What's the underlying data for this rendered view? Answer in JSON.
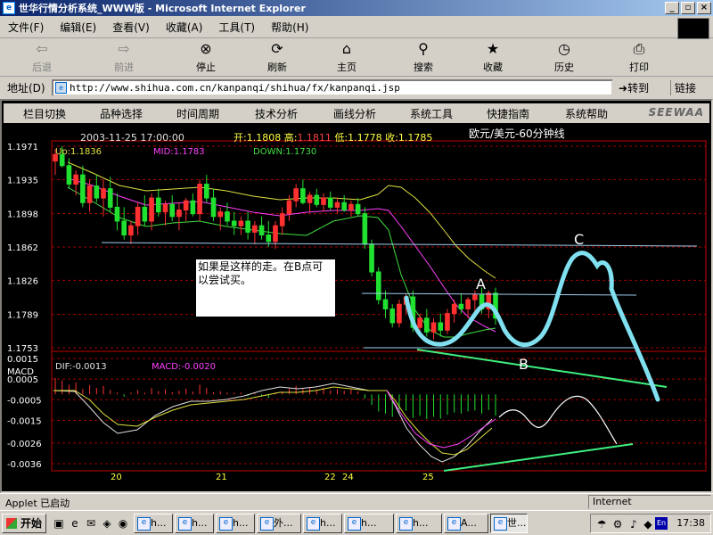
{
  "window": {
    "title": "世华行情分析系统_WWW版 - Microsoft Internet Explorer"
  },
  "menu": [
    "文件(F)",
    "编辑(E)",
    "查看(V)",
    "收藏(A)",
    "工具(T)",
    "帮助(H)"
  ],
  "toolbar": [
    {
      "label": "后退",
      "icon": "back-arrow-icon",
      "enabled": false
    },
    {
      "label": "前进",
      "icon": "forward-arrow-icon",
      "enabled": false
    },
    {
      "label": "停止",
      "icon": "stop-icon",
      "enabled": true
    },
    {
      "label": "刷新",
      "icon": "refresh-icon",
      "enabled": true
    },
    {
      "label": "主页",
      "icon": "home-icon",
      "enabled": true
    },
    {
      "label": "搜索",
      "icon": "search-icon",
      "enabled": true
    },
    {
      "label": "收藏",
      "icon": "favorites-icon",
      "enabled": true
    },
    {
      "label": "历史",
      "icon": "history-icon",
      "enabled": true
    },
    {
      "label": "打印",
      "icon": "print-icon",
      "enabled": true
    }
  ],
  "address": {
    "label": "地址(D)",
    "url": "http://www.shihua.com.cn/kanpanqi/shihua/fx/kanpanqi.jsp",
    "go": "转到",
    "links": "链接"
  },
  "app_menu": [
    "栏目切换",
    "品种选择",
    "时间周期",
    "技术分析",
    "画线分析",
    "系统工具",
    "快捷指南",
    "系统帮助"
  ],
  "app_logo": "SEEWAA",
  "quote": {
    "datetime": "2003-11-25 17:00:00",
    "open_label": "开:",
    "open": "1.1808",
    "high_label": "高:",
    "high": "1.1811",
    "low_label": "低:",
    "low": "1.1778",
    "close_label": "收:",
    "close": "1.1785",
    "symbol": "欧元/美元-60分钟线"
  },
  "bollinger": {
    "up": "Up:1.1836",
    "mid": "MID:1.1783",
    "down": "DOWN:1.1730"
  },
  "macd_info": {
    "label": "MACD",
    "dif": "DIF:-0.0013",
    "macd": "MACD:-0.0020"
  },
  "annotation": {
    "text": "如果是这样的走。在B点可以尝试买。",
    "labels": [
      "A",
      "B",
      "C"
    ]
  },
  "colors": {
    "up": "#ff3030",
    "down": "#20e030",
    "mid": "#ff40ff",
    "upper": "#e0e040",
    "lower": "#40e040",
    "hand": "#80e0f0",
    "trend": "#40f080"
  },
  "chart_data": {
    "type": "candlestick",
    "price_axis": {
      "ticks": [
        "1.1971",
        "1.1935",
        "1.1898",
        "1.1862",
        "1.1826",
        "1.1789",
        "1.1753"
      ],
      "range": [
        1.1753,
        1.1971
      ]
    },
    "macd_axis": {
      "ticks": [
        "0.0015",
        "0.0005",
        "-0.0005",
        "-0.0015",
        "-0.0026",
        "-0.0036"
      ],
      "range": [
        -0.0036,
        0.0015
      ]
    },
    "x_ticks": [
      "20",
      "21",
      "22",
      "24",
      "25"
    ],
    "candles": [
      [
        1.1955,
        1.1968,
        1.194,
        1.1962
      ],
      [
        1.1962,
        1.1971,
        1.1948,
        1.195
      ],
      [
        1.195,
        1.1958,
        1.1925,
        1.193
      ],
      [
        1.193,
        1.1945,
        1.1918,
        1.194
      ],
      [
        1.194,
        1.195,
        1.1905,
        1.191
      ],
      [
        1.191,
        1.1935,
        1.19,
        1.1928
      ],
      [
        1.1928,
        1.194,
        1.191,
        1.1915
      ],
      [
        1.1915,
        1.1935,
        1.1895,
        1.1925
      ],
      [
        1.1925,
        1.1938,
        1.19,
        1.1905
      ],
      [
        1.1905,
        1.192,
        1.188,
        1.189
      ],
      [
        1.189,
        1.1905,
        1.187,
        1.1875
      ],
      [
        1.1875,
        1.189,
        1.1865,
        1.1885
      ],
      [
        1.1885,
        1.191,
        1.1875,
        1.1905
      ],
      [
        1.1905,
        1.1918,
        1.1885,
        1.189
      ],
      [
        1.189,
        1.192,
        1.188,
        1.1915
      ],
      [
        1.1915,
        1.1925,
        1.1895,
        1.19
      ],
      [
        1.19,
        1.1912,
        1.1885,
        1.1908
      ],
      [
        1.1908,
        1.1918,
        1.189,
        1.1895
      ],
      [
        1.1895,
        1.191,
        1.188,
        1.1902
      ],
      [
        1.1902,
        1.1915,
        1.189,
        1.1912
      ],
      [
        1.1912,
        1.192,
        1.1895,
        1.1898
      ],
      [
        1.1898,
        1.1935,
        1.189,
        1.193
      ],
      [
        1.193,
        1.194,
        1.191,
        1.1915
      ],
      [
        1.1915,
        1.1925,
        1.189,
        1.1895
      ],
      [
        1.1895,
        1.1905,
        1.188,
        1.19
      ],
      [
        1.19,
        1.191,
        1.1885,
        1.189
      ],
      [
        1.189,
        1.19,
        1.1875,
        1.1885
      ],
      [
        1.1885,
        1.1895,
        1.1875,
        1.189
      ],
      [
        1.189,
        1.19,
        1.187,
        1.1878
      ],
      [
        1.1878,
        1.189,
        1.1865,
        1.1885
      ],
      [
        1.1885,
        1.1895,
        1.187,
        1.1875
      ],
      [
        1.1875,
        1.189,
        1.1862,
        1.1868
      ],
      [
        1.1868,
        1.189,
        1.186,
        1.1885
      ],
      [
        1.1885,
        1.1905,
        1.1875,
        1.1898
      ],
      [
        1.1898,
        1.1918,
        1.189,
        1.1912
      ],
      [
        1.1912,
        1.193,
        1.1905,
        1.1925
      ],
      [
        1.1925,
        1.1935,
        1.1908,
        1.191
      ],
      [
        1.191,
        1.1922,
        1.19,
        1.1918
      ],
      [
        1.1918,
        1.1925,
        1.1905,
        1.1908
      ],
      [
        1.1908,
        1.192,
        1.19,
        1.1915
      ],
      [
        1.1915,
        1.1922,
        1.1902,
        1.1905
      ],
      [
        1.1905,
        1.1915,
        1.1898,
        1.191
      ],
      [
        1.191,
        1.1918,
        1.19,
        1.1902
      ],
      [
        1.1902,
        1.1912,
        1.1895,
        1.1908
      ],
      [
        1.1908,
        1.1915,
        1.1895,
        1.1898
      ],
      [
        1.1898,
        1.1905,
        1.186,
        1.1865
      ],
      [
        1.1865,
        1.187,
        1.183,
        1.1835
      ],
      [
        1.1835,
        1.184,
        1.18,
        1.1805
      ],
      [
        1.1805,
        1.1815,
        1.1785,
        1.1795
      ],
      [
        1.1795,
        1.18,
        1.1775,
        1.178
      ],
      [
        1.178,
        1.1805,
        1.1775,
        1.18
      ],
      [
        1.18,
        1.1812,
        1.179,
        1.1808
      ],
      [
        1.1808,
        1.1815,
        1.177,
        1.1775
      ],
      [
        1.1775,
        1.179,
        1.1765,
        1.1785
      ],
      [
        1.1785,
        1.1795,
        1.1765,
        1.177
      ],
      [
        1.177,
        1.1785,
        1.1762,
        1.178
      ],
      [
        1.178,
        1.179,
        1.1765,
        1.1772
      ],
      [
        1.1772,
        1.1795,
        1.1768,
        1.179
      ],
      [
        1.179,
        1.1805,
        1.178,
        1.18
      ],
      [
        1.18,
        1.1812,
        1.179,
        1.1795
      ],
      [
        1.1795,
        1.1808,
        1.1785,
        1.1805
      ],
      [
        1.1805,
        1.1815,
        1.179,
        1.181
      ],
      [
        1.181,
        1.1818,
        1.179,
        1.1795
      ],
      [
        1.1795,
        1.1815,
        1.1785,
        1.1812
      ],
      [
        1.1812,
        1.1818,
        1.1778,
        1.1785
      ]
    ]
  },
  "status": {
    "text": "Applet 已启动",
    "zone": "Internet"
  },
  "taskbar": {
    "start": "开始",
    "tasks": [
      "h...",
      "h...",
      "h...",
      "外...",
      "h...",
      "h...",
      "h...",
      "A...",
      "世..."
    ],
    "clock": "17:38",
    "lang": "En"
  }
}
